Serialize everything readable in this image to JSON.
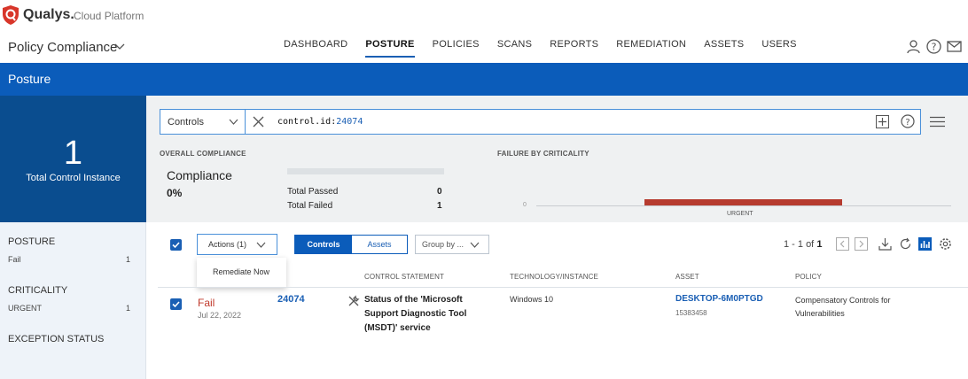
{
  "brand": {
    "name": "Qualys.",
    "subtitle": "Cloud Platform"
  },
  "app": {
    "title": "Policy Compliance"
  },
  "nav": [
    {
      "label": "DASHBOARD",
      "active": false
    },
    {
      "label": "POSTURE",
      "active": true
    },
    {
      "label": "POLICIES",
      "active": false
    },
    {
      "label": "SCANS",
      "active": false
    },
    {
      "label": "REPORTS",
      "active": false
    },
    {
      "label": "REMEDIATION",
      "active": false
    },
    {
      "label": "ASSETS",
      "active": false
    },
    {
      "label": "USERS",
      "active": false
    }
  ],
  "top_icons": [
    "user-icon",
    "help-icon",
    "mail-icon"
  ],
  "page": {
    "title": "Posture"
  },
  "summary": {
    "count": "1",
    "label": "Total Control Instance"
  },
  "filters": {
    "posture": {
      "heading": "POSTURE",
      "item": "Fail",
      "count": "1"
    },
    "criticality": {
      "heading": "CRITICALITY",
      "item": "URGENT",
      "count": "1"
    },
    "exception": {
      "heading": "EXCEPTION STATUS"
    }
  },
  "search": {
    "scope": "Controls",
    "query_key": "control.id:",
    "query_value": "24074"
  },
  "overall": {
    "section_title": "OVERALL COMPLIANCE",
    "title": "Compliance",
    "percent": "0%",
    "passed_label": "Total Passed",
    "passed_value": "0",
    "failed_label": "Total Failed",
    "failed_value": "1"
  },
  "criticality_chart": {
    "section_title": "FAILURE BY CRITICALITY",
    "zero_label": "0",
    "bar_label": "URGENT",
    "value": 1
  },
  "toolbar": {
    "actions_label": "Actions (1)",
    "tab_controls": "Controls",
    "tab_assets": "Assets",
    "group_by": "Group by ...",
    "pager_text": "1 - 1 of",
    "pager_total": "1"
  },
  "dropdown": {
    "item": "Remediate Now"
  },
  "table": {
    "headers": {
      "statement": "CONTROL STATEMENT",
      "technology": "TECHNOLOGY/INSTANCE",
      "asset": "ASSET",
      "policy": "POLICY"
    },
    "row": {
      "status": "Fail",
      "date": "Jul 22, 2022",
      "control_id": "24074",
      "statement": "Status of the 'Microsoft Support Diagnostic Tool (MSDT)' service",
      "technology": "Windows 10",
      "asset_name": "DESKTOP-6M0PTGD",
      "asset_id": "15383458",
      "policy": "Compensatory Controls for Vulnerabilities"
    }
  },
  "colors": {
    "brand_red": "#d8362a",
    "header_blue": "#0b5cba",
    "summary_blue": "#0a4d8f",
    "fail_red": "#c0392b",
    "bar_red": "#b63b2f"
  }
}
